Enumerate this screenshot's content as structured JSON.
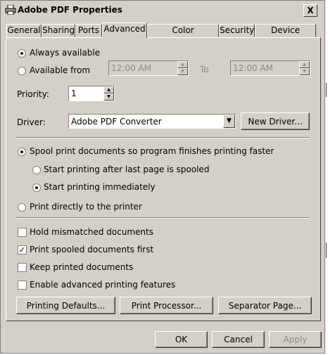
{
  "window": {
    "title": "Adobe PDF Properties",
    "close_label": "X"
  },
  "tabs": [
    {
      "label": "General"
    },
    {
      "label": "Sharing"
    },
    {
      "label": "Ports"
    },
    {
      "label": "Advanced"
    },
    {
      "label": "Color Management"
    },
    {
      "label": "Security"
    },
    {
      "label": "Device Settings"
    }
  ],
  "active_tab": "Advanced",
  "availability": {
    "always_label": "Always available",
    "from_label": "Available from",
    "from_time": "12:00 AM",
    "to_label": "To",
    "to_time": "12:00 AM",
    "selected": "always"
  },
  "priority": {
    "label": "Priority:",
    "value": "1"
  },
  "driver": {
    "label": "Driver:",
    "value": "Adobe PDF Converter",
    "new_driver_label": "New Driver..."
  },
  "spooling": {
    "spool_label": "Spool print documents so program finishes printing faster",
    "after_last_page_label": "Start printing after last page is spooled",
    "immediately_label": "Start printing immediately",
    "direct_label": "Print directly to the printer",
    "selected_mode": "spool",
    "selected_start": "immediately"
  },
  "options": {
    "hold_mismatched": {
      "label": "Hold mismatched documents",
      "checked": false
    },
    "spooled_first": {
      "label": "Print spooled documents first",
      "checked": true
    },
    "keep_printed": {
      "label": "Keep printed documents",
      "checked": false
    },
    "advanced_features": {
      "label": "Enable advanced printing features",
      "checked": false
    }
  },
  "panel_buttons": {
    "printing_defaults": "Printing Defaults...",
    "print_processor": "Print Processor...",
    "separator_page": "Separator Page..."
  },
  "dialog_buttons": {
    "ok": "OK",
    "cancel": "Cancel",
    "apply": "Apply"
  },
  "icons": {
    "title": "printer-icon",
    "check_mark": "✓"
  }
}
